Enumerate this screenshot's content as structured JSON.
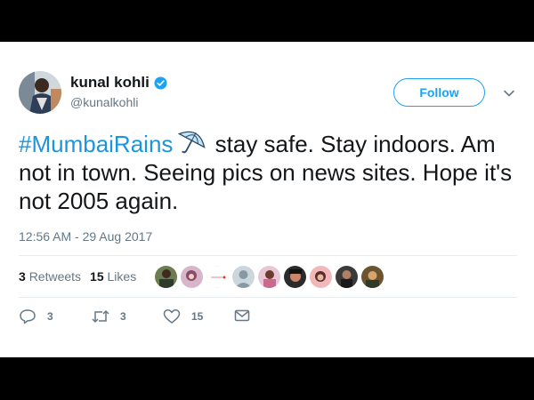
{
  "tweet": {
    "author_name": "kunal kohli",
    "author_handle": "@kunalkohli",
    "follow_label": "Follow",
    "hashtag": "#MumbaiRains",
    "text_rest": " stay safe. Stay indoors. Am not in town. Seeing pics on news sites. Hope it's not 2005 again.",
    "timestamp": "12:56 AM - 29 Aug 2017"
  },
  "stats": {
    "retweets_count": "3",
    "retweets_label": "Retweets",
    "likes_count": "15",
    "likes_label": "Likes"
  },
  "actions": {
    "reply_count": "3",
    "retweet_count": "3",
    "like_count": "15"
  },
  "icons": {
    "verified": "verified-badge-icon",
    "umbrella": "umbrella-icon",
    "chevron": "chevron-down-icon",
    "reply": "reply-icon",
    "retweet": "retweet-icon",
    "like": "heart-icon",
    "dm": "envelope-icon"
  },
  "colors": {
    "brand": "#1da1f2",
    "hashtag": "#1b95e0",
    "text": "#14171a",
    "muted": "#657786"
  }
}
